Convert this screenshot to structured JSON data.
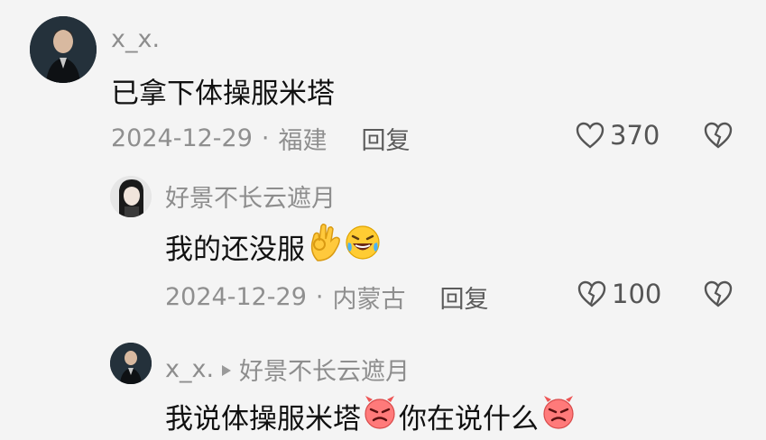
{
  "comments": [
    {
      "username": "x_x.",
      "text": "已拿下体操服米塔",
      "date": "2024-12-29",
      "location": "福建",
      "reply_label": "回复",
      "likes": "370"
    },
    {
      "username": "好景不长云遮月",
      "text": "我的还没服",
      "date": "2024-12-29",
      "location": "内蒙古",
      "reply_label": "回复",
      "likes": "100"
    },
    {
      "username": "x_x.",
      "reply_to": "好景不长云遮月",
      "text_part1": "我说体操服米塔",
      "text_part2": "你在说什么"
    }
  ],
  "separator": "·",
  "icons": {
    "like": "heart-outline-icon",
    "liked": "heart-filled-icon",
    "dislike": "broken-heart-icon",
    "ok_hand": "ok-hand-emoji",
    "laugh": "rolling-laughing-emoji",
    "angry": "angry-face-emoji",
    "reply_arrow": "triangle-right-icon"
  },
  "colors": {
    "text": "#111111",
    "secondary": "#8f8f8f",
    "background": "#f4f4f4"
  }
}
